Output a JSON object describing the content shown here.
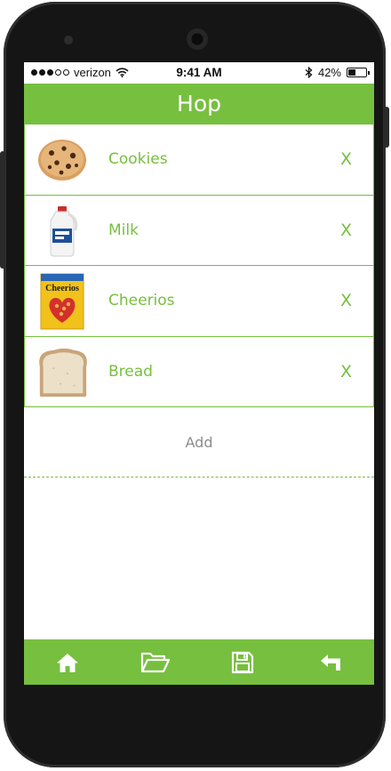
{
  "status_bar": {
    "carrier": "verizon",
    "time": "9:41 AM",
    "battery": "42%",
    "battery_level": 0.42,
    "signal_bars_filled": 3,
    "signal_bars_total": 5
  },
  "header": {
    "title": "Hop"
  },
  "items": [
    {
      "name": "Cookies",
      "remove_label": "X",
      "image_icon": "cookie-icon"
    },
    {
      "name": "Milk",
      "remove_label": "X",
      "image_icon": "milk-jug-icon"
    },
    {
      "name": "Cheerios",
      "remove_label": "X",
      "image_icon": "cereal-box-icon",
      "image_text": "Cheerios"
    },
    {
      "name": "Bread",
      "remove_label": "X",
      "image_icon": "bread-slice-icon"
    }
  ],
  "add": {
    "label": "Add"
  },
  "tab_bar": {
    "tabs": [
      {
        "icon": "home-icon"
      },
      {
        "icon": "folder-open-icon"
      },
      {
        "icon": "save-icon"
      },
      {
        "icon": "back-arrow-icon"
      }
    ]
  },
  "colors": {
    "accent": "#77bf3f",
    "placeholder_text": "#8c8c8c",
    "device_body": "#151515"
  }
}
